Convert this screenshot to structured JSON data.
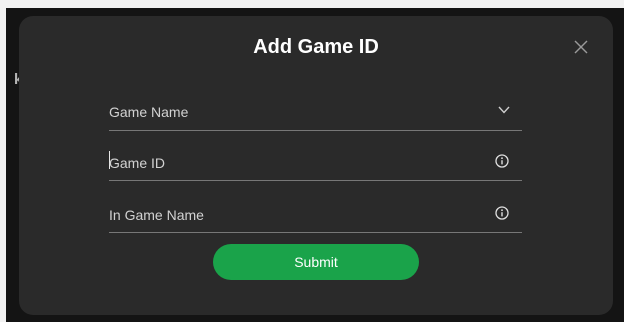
{
  "backdrop": {
    "fragment_text": "k"
  },
  "modal": {
    "title": "Add Game ID",
    "close_icon": "close-icon"
  },
  "form": {
    "game_name": {
      "value": "Game Name",
      "icon": "chevron-down-icon"
    },
    "game_id": {
      "placeholder": "Game ID",
      "value": "",
      "icon": "info-icon"
    },
    "in_game_name": {
      "placeholder": "In Game Name",
      "value": "",
      "icon": "info-icon"
    },
    "submit_label": "Submit"
  },
  "colors": {
    "modal_background": "#2a2a2a",
    "backdrop": "#141414",
    "accent_green": "#1aa34a",
    "text_primary": "#ffffff",
    "text_secondary": "#d2d2d2",
    "underline": "#777777"
  }
}
